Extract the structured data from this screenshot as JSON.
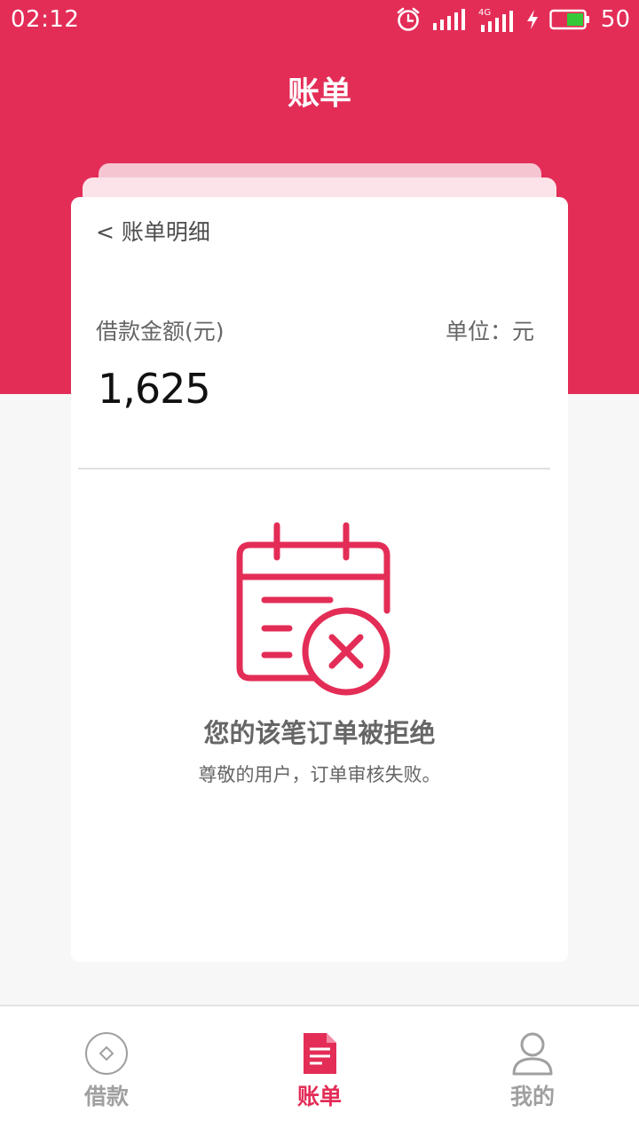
{
  "status_bar": {
    "time": "02:12",
    "network_label": "4G",
    "battery": "50",
    "icons": [
      "alarm-clock-icon",
      "signal-icon",
      "charging-icon",
      "battery-icon"
    ]
  },
  "header": {
    "title": "账单"
  },
  "card": {
    "back_label": "< 账单明细",
    "amount_label": "借款金额(元)",
    "unit_label": "单位：元",
    "amount_value": "1,625"
  },
  "result": {
    "icon": "calendar-rejected-icon",
    "title": "您的该笔订单被拒绝",
    "subtitle": "尊敬的用户，订单审核失败。"
  },
  "tabbar": {
    "active": "bill",
    "items": [
      {
        "id": "loan",
        "label": "借款",
        "icon": "loan-diamond-icon"
      },
      {
        "id": "bill",
        "label": "账单",
        "icon": "bill-document-icon"
      },
      {
        "id": "mine",
        "label": "我的",
        "icon": "user-profile-icon"
      }
    ]
  },
  "colors": {
    "brand": "#e32d57",
    "battery_fill": "#35c93a",
    "tab_inactive": "#a0a0a0",
    "text_gray": "#666666"
  }
}
